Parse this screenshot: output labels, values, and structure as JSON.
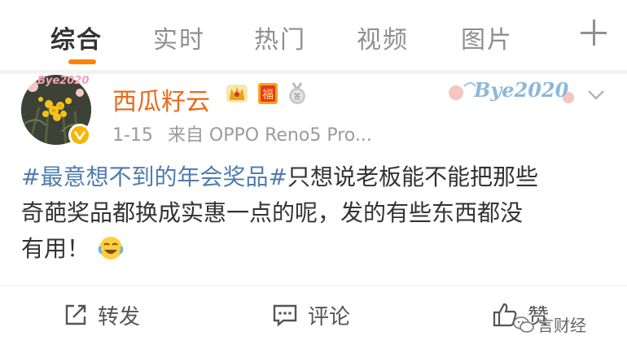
{
  "tabs": [
    {
      "label": "综合",
      "active": true
    },
    {
      "label": "实时",
      "active": false
    },
    {
      "label": "热门",
      "active": false
    },
    {
      "label": "视频",
      "active": false
    },
    {
      "label": "图片",
      "active": false
    }
  ],
  "accent_color": "#ff8200",
  "post": {
    "username": "西瓜籽云",
    "username_color": "#e86b1c",
    "badges": [
      "crown-badge-icon",
      "fu-badge-icon",
      "medal-badge-icon"
    ],
    "avatar_overlay_text": "Bye2020",
    "decor_badge_text": "Bye2020",
    "timestamp": "1-15",
    "source": "来自 OPPO Reno5 Pro...",
    "hashtag": "#最意想不到的年会奖品#",
    "body_line1": "只想说老板能不能把那些",
    "body_line2": "奇葩奖品都换成实惠一点的呢，发的有些东西都没",
    "body_line3": "有用！",
    "hashtag_color": "#507daf"
  },
  "actions": {
    "repost": "转发",
    "comment": "评论",
    "like": "赞"
  },
  "watermark": "言财经"
}
